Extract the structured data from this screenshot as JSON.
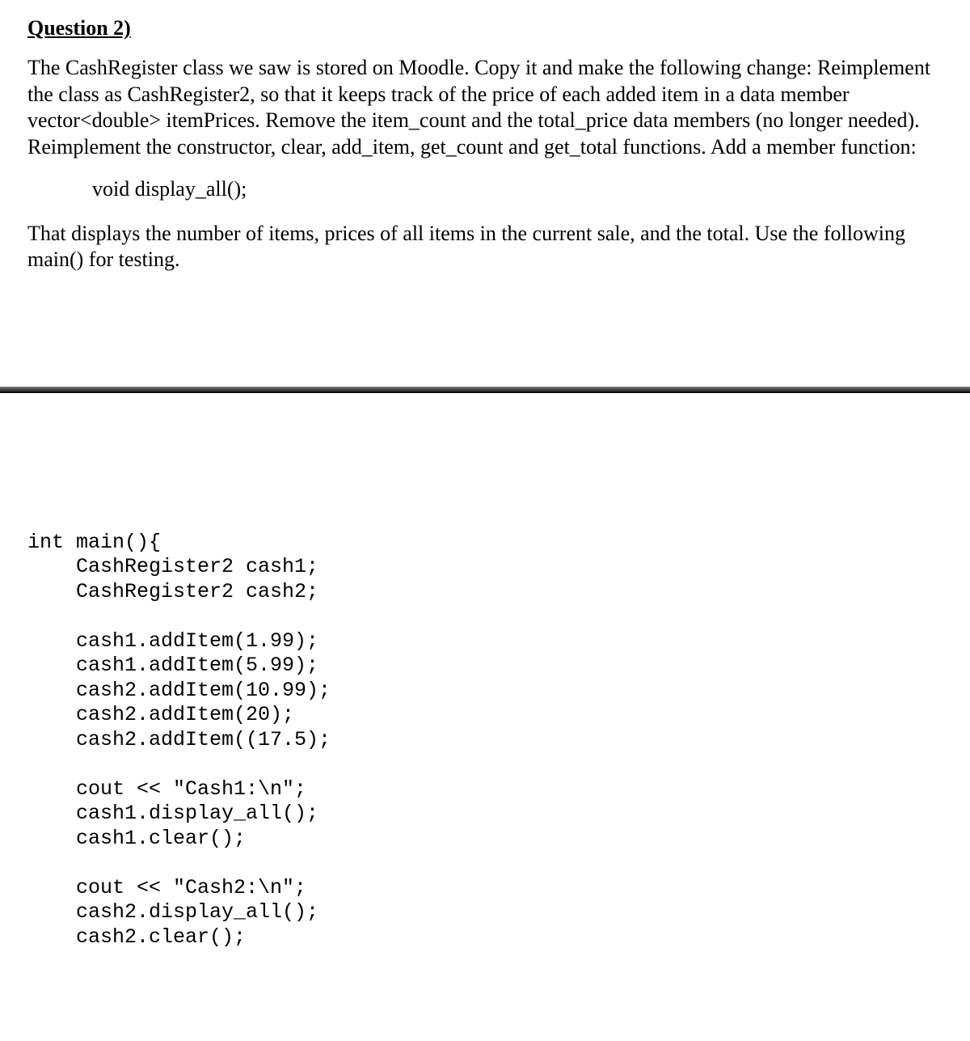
{
  "heading": "Question 2)",
  "para1": "The CashRegister class we saw is stored on Moodle. Copy it and make the following change: Reimplement the class as CashRegister2, so that it keeps track of the price of each added item in a data member vector<double> itemPrices. Remove the item_count and the total_price data members (no longer needed). Reimplement the constructor, clear, add_item, get_count and get_total functions. Add a member function:",
  "func": "void display_all();",
  "para2": "That displays the number of items, prices of all items in the current sale, and the total. Use the following main() for testing.",
  "code": "int main(){\n    CashRegister2 cash1;\n    CashRegister2 cash2;\n\n    cash1.addItem(1.99);\n    cash1.addItem(5.99);\n    cash2.addItem(10.99);\n    cash2.addItem(20);\n    cash2.addItem((17.5);\n\n    cout << \"Cash1:\\n\";\n    cash1.display_all();\n    cash1.clear();\n\n    cout << \"Cash2:\\n\";\n    cash2.display_all();\n    cash2.clear();"
}
